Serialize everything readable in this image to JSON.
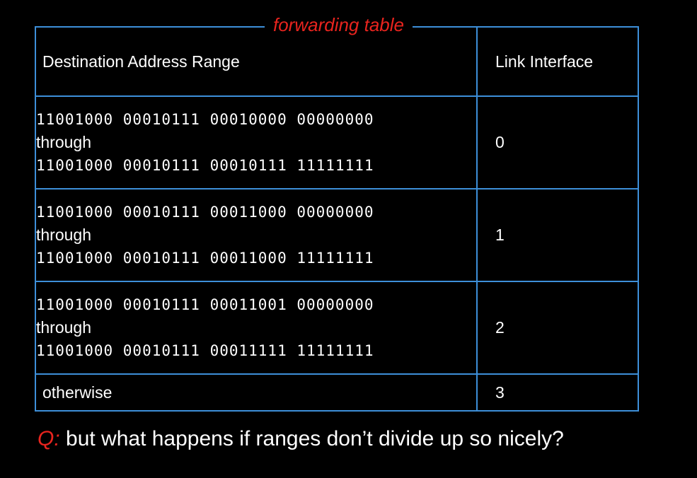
{
  "table": {
    "title": "forwarding table",
    "headers": {
      "destination": "Destination Address Range",
      "link": "Link Interface"
    },
    "rows": [
      {
        "start": "11001000 00010111 00010000 00000000",
        "through": "through",
        "end": "11001000 00010111 00010111 11111111",
        "link": "0"
      },
      {
        "start": "11001000 00010111 00011000 00000000",
        "through": "through",
        "end": "11001000 00010111 00011000 11111111",
        "link": "1"
      },
      {
        "start": "11001000 00010111 00011001 00000000",
        "through": "through",
        "end": "11001000 00010111 00011111 11111111",
        "link": "2"
      }
    ],
    "otherwise": {
      "label": "otherwise",
      "link": "3"
    }
  },
  "question": {
    "marker": "Q:",
    "text": " but what happens if ranges don’t divide up so nicely?"
  },
  "colors": {
    "background": "#000000",
    "border": "#3d8fd9",
    "accent_red": "#e8241e",
    "text": "#ffffff"
  }
}
